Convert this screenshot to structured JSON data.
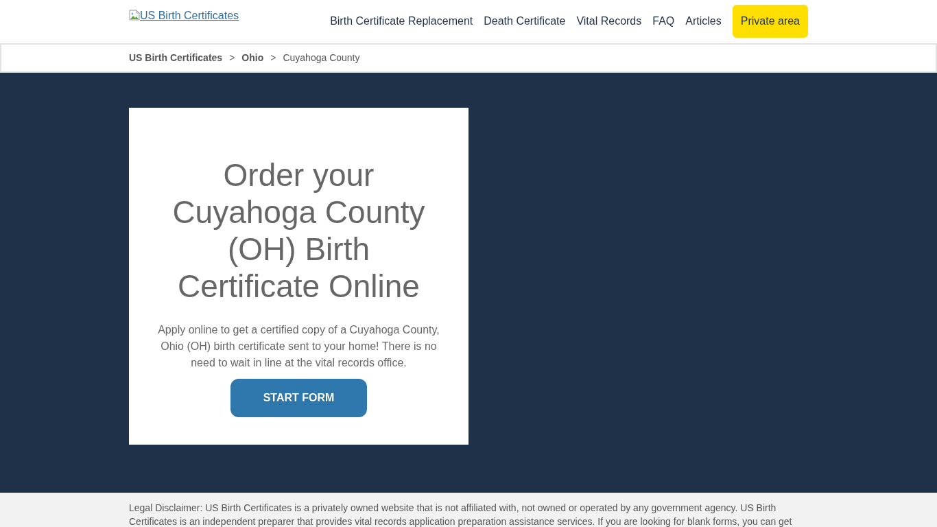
{
  "header": {
    "logo": {
      "alt_text": "US Birth Certificates"
    },
    "nav": [
      {
        "label": "Birth Certificate Replacement",
        "kind": "link"
      },
      {
        "label": "Death Certificate",
        "kind": "link"
      },
      {
        "label": "Vital Records",
        "kind": "link"
      },
      {
        "label": "FAQ",
        "kind": "link"
      },
      {
        "label": "Articles",
        "kind": "link"
      },
      {
        "label": "Private area",
        "kind": "button"
      }
    ]
  },
  "breadcrumb": [
    {
      "label": "US Birth Certificates",
      "current": false
    },
    {
      "label": "Ohio",
      "current": false,
      "separator": ">"
    },
    {
      "label": "Cuyahoga County",
      "current": true,
      "separator": ">"
    }
  ],
  "hero": {
    "title": "Order your Cuyahoga County (OH) Birth Certificate Online",
    "text": "Apply online to get a certified copy of a Cuyahoga County, Ohio (OH) birth certificate sent to your home! There is no need to wait in line at the vital records office.",
    "button": "START FORM"
  },
  "footer": {
    "disclaimer": "Legal Disclaimer: US Birth Certificates is a privately owned website that is not affiliated with, not owned or operated by any government agency. US Birth Certificates is an independent preparer that provides vital records application preparation assistance services. If you are looking for blank forms, you can get"
  }
}
